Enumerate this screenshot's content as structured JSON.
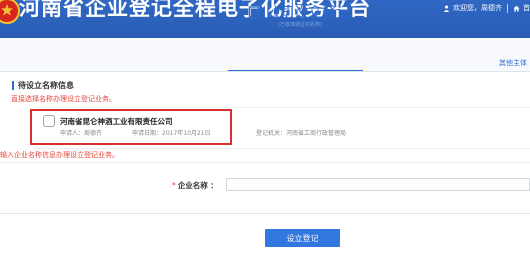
{
  "header": {
    "title": "河南省企业登记全程电子化服务平台",
    "welcome": "欢迎您，周德齐",
    "home_label": "首"
  },
  "page": {
    "title": "公司设立登记",
    "subtitle": "[已核准通过的名称]",
    "other_link": "其他主体"
  },
  "pending": {
    "section_title": "待设立名称信息",
    "hint": "直接选择名称办理设立登记业务。",
    "items": [
      {
        "company": "河南省昆仑神酒工业有限责任公司",
        "applicant": "申请人：周德齐",
        "apply_date": "申请日期：2017年10月21日",
        "authority": "登记机关：河南省工商行政管理局"
      }
    ]
  },
  "manual": {
    "hint": "输入企业名称信息办理设立登记业务。",
    "field_label": "企业名称 ：",
    "required_mark": "*",
    "field_value": ""
  },
  "submit_label": "设立登记",
  "colors": {
    "header_blue": "#2b5fb8",
    "accent_blue": "#2e6bd0",
    "warning_red": "#e8453c",
    "highlight_red": "#d92f2f"
  },
  "icons": {
    "emblem": "national-emblem-icon",
    "user": "user-icon",
    "home": "home-icon",
    "edit": "edit-form-icon"
  }
}
